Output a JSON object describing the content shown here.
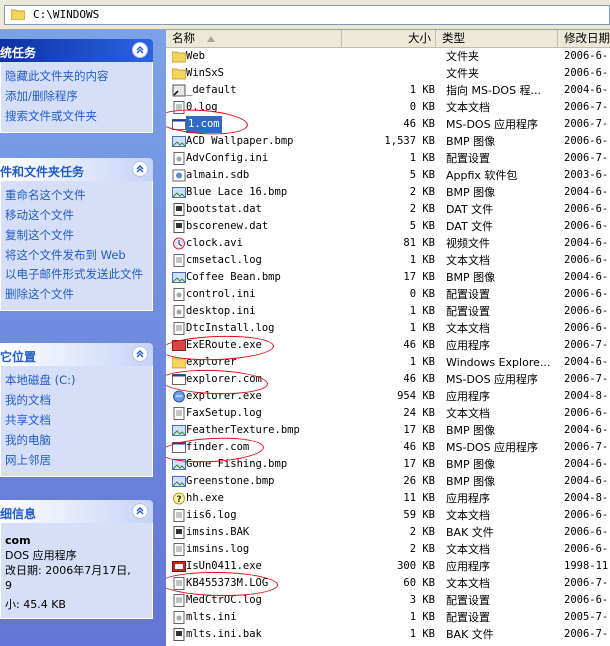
{
  "address": {
    "path": "C:\\WINDOWS"
  },
  "tasks": {
    "file_folder": {
      "title": "文件和文件夹任务",
      "items": [
        "隐藏此文件夹的内容",
        "添加/删除程序",
        "搜索文件或文件夹"
      ],
      "title_short": "统任务"
    },
    "file_tasks": {
      "title": "件和文件夹任务",
      "items": [
        "重命名这个文件",
        "移动这个文件",
        "复制这个文件",
        "将这个文件发布到 Web",
        "以电子邮件形式发送此文件",
        "删除这个文件"
      ]
    },
    "places": {
      "title": "它位置",
      "items": [
        "本地磁盘 (C:)",
        "我的文档",
        "共享文档",
        "我的电脑",
        "网上邻居"
      ]
    },
    "details": {
      "title": "细信息",
      "name": "com",
      "type": "DOS 应用程序",
      "modified": "改日期: 2006年7月17日,",
      "time": "9",
      "size": "小: 45.4 KB"
    }
  },
  "columns": {
    "name": "名称",
    "size": "大小",
    "type": "类型",
    "date": "修改日期"
  },
  "files": [
    {
      "name": "Web",
      "size": "",
      "type": "文件夹",
      "date": "2006-6-",
      "icon": "folder"
    },
    {
      "name": "WinSxS",
      "size": "",
      "type": "文件夹",
      "date": "2006-6-",
      "icon": "folder"
    },
    {
      "name": "_default",
      "size": "1 KB",
      "type": "指向 MS-DOS 程...",
      "date": "2004-6-",
      "icon": "shortcut"
    },
    {
      "name": "0.log",
      "size": "0 KB",
      "type": "文本文档",
      "date": "2006-7-",
      "icon": "text"
    },
    {
      "name": "1.com",
      "size": "46 KB",
      "type": "MS-DOS 应用程序",
      "date": "2006-7-",
      "icon": "dos",
      "selected": true
    },
    {
      "name": "ACD Wallpaper.bmp",
      "size": "1,537 KB",
      "type": "BMP 图像",
      "date": "2006-6-",
      "icon": "image"
    },
    {
      "name": "AdvConfig.ini",
      "size": "1 KB",
      "type": "配置设置",
      "date": "2006-7-",
      "icon": "ini"
    },
    {
      "name": "almain.sdb",
      "size": "5 KB",
      "type": "Appfix 软件包",
      "date": "2003-6-",
      "icon": "sdb"
    },
    {
      "name": "Blue Lace 16.bmp",
      "size": "2 KB",
      "type": "BMP 图像",
      "date": "2004-6-",
      "icon": "image"
    },
    {
      "name": "bootstat.dat",
      "size": "2 KB",
      "type": "DAT 文件",
      "date": "2006-6-",
      "icon": "dat"
    },
    {
      "name": "bscorenew.dat",
      "size": "5 KB",
      "type": "DAT 文件",
      "date": "2006-6-",
      "icon": "dat"
    },
    {
      "name": "clock.avi",
      "size": "81 KB",
      "type": "视频文件",
      "date": "2004-6-",
      "icon": "video"
    },
    {
      "name": "cmsetacl.log",
      "size": "1 KB",
      "type": "文本文档",
      "date": "2006-6-",
      "icon": "text"
    },
    {
      "name": "Coffee Bean.bmp",
      "size": "17 KB",
      "type": "BMP 图像",
      "date": "2004-6-",
      "icon": "image"
    },
    {
      "name": "control.ini",
      "size": "0 KB",
      "type": "配置设置",
      "date": "2006-6-",
      "icon": "ini"
    },
    {
      "name": "desktop.ini",
      "size": "1 KB",
      "type": "配置设置",
      "date": "2006-6-",
      "icon": "ini"
    },
    {
      "name": "DtcInstall.log",
      "size": "1 KB",
      "type": "文本文档",
      "date": "2006-6-",
      "icon": "text"
    },
    {
      "name": "ExERoute.exe",
      "size": "46 KB",
      "type": "应用程序",
      "date": "2006-7-",
      "icon": "exe-red"
    },
    {
      "name": "explorer",
      "size": "1 KB",
      "type": "Windows Explore...",
      "date": "2004-6-",
      "icon": "folder"
    },
    {
      "name": "explorer.com",
      "size": "46 KB",
      "type": "MS-DOS 应用程序",
      "date": "2006-7-",
      "icon": "dos"
    },
    {
      "name": "explorer.exe",
      "size": "954 KB",
      "type": "应用程序",
      "date": "2004-8-",
      "icon": "explorer"
    },
    {
      "name": "FaxSetup.log",
      "size": "24 KB",
      "type": "文本文档",
      "date": "2006-6-",
      "icon": "text"
    },
    {
      "name": "FeatherTexture.bmp",
      "size": "17 KB",
      "type": "BMP 图像",
      "date": "2004-6-",
      "icon": "image"
    },
    {
      "name": "finder.com",
      "size": "46 KB",
      "type": "MS-DOS 应用程序",
      "date": "2006-7-",
      "icon": "dos"
    },
    {
      "name": "Gone Fishing.bmp",
      "size": "17 KB",
      "type": "BMP 图像",
      "date": "2004-6-",
      "icon": "image"
    },
    {
      "name": "Greenstone.bmp",
      "size": "26 KB",
      "type": "BMP 图像",
      "date": "2004-6-",
      "icon": "image"
    },
    {
      "name": "hh.exe",
      "size": "11 KB",
      "type": "应用程序",
      "date": "2004-8-",
      "icon": "help"
    },
    {
      "name": "iis6.log",
      "size": "59 KB",
      "type": "文本文档",
      "date": "2006-6-",
      "icon": "text"
    },
    {
      "name": "imsins.BAK",
      "size": "2 KB",
      "type": "BAK 文件",
      "date": "2006-6-",
      "icon": "dat"
    },
    {
      "name": "imsins.log",
      "size": "2 KB",
      "type": "文本文档",
      "date": "2006-6-",
      "icon": "text"
    },
    {
      "name": "IsUn0411.exe",
      "size": "300 KB",
      "type": "应用程序",
      "date": "1998-11-",
      "icon": "exe"
    },
    {
      "name": "KB455373M.LOG",
      "size": "60 KB",
      "type": "文本文档",
      "date": "2006-7-",
      "icon": "text"
    },
    {
      "name": "MedCtrOC.log",
      "size": "3 KB",
      "type": "配置设置",
      "date": "2006-6-",
      "icon": "text"
    },
    {
      "name": "mlts.ini",
      "size": "1 KB",
      "type": "配置设置",
      "date": "2005-7-",
      "icon": "ini"
    },
    {
      "name": "mlts.ini.bak",
      "size": "1 KB",
      "type": "BAK 文件",
      "date": "2006-7-",
      "icon": "dat"
    }
  ],
  "colors": {
    "link": "#215dc6",
    "pane": "#6375d6",
    "annotation": "#e0101a"
  }
}
